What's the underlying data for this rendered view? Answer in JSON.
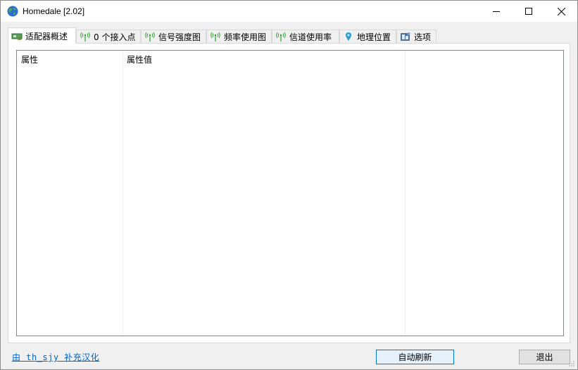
{
  "window": {
    "title": "Homedale [2.02]"
  },
  "tabs": [
    {
      "label": "适配器概述",
      "icon": "network-adapter-icon",
      "active": true
    },
    {
      "label": "0 个接入点",
      "icon": "wifi-signal-icon",
      "active": false
    },
    {
      "label": "信号强度图",
      "icon": "wifi-signal-icon",
      "active": false
    },
    {
      "label": "频率使用图",
      "icon": "wifi-signal-icon",
      "active": false
    },
    {
      "label": "信道使用率",
      "icon": "wifi-signal-icon",
      "active": false
    },
    {
      "label": "地理位置",
      "icon": "location-pin-icon",
      "active": false
    },
    {
      "label": "选项",
      "icon": "settings-icon",
      "active": false
    }
  ],
  "list": {
    "columns": [
      "属性",
      "属性值",
      ""
    ],
    "rows": []
  },
  "footer": {
    "credit_link": "由 th_sjy 补充汉化",
    "refresh_label": "自动刷新",
    "exit_label": "退出"
  },
  "colors": {
    "accent": "#0078d7",
    "link": "#0066cc",
    "signal_green": "#2e9e2e"
  }
}
